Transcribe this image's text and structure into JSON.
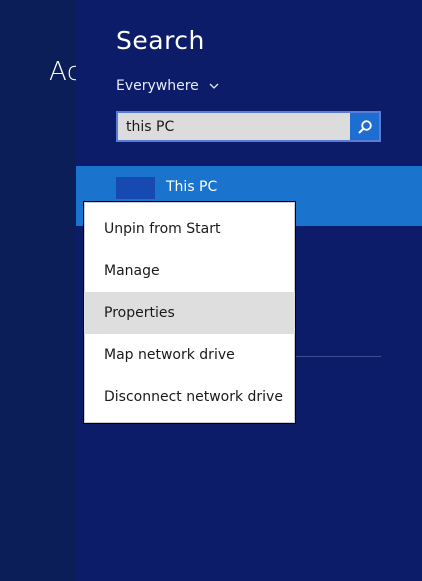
{
  "start_screen": {
    "peek_text": "Ac"
  },
  "search": {
    "title": "Search",
    "scope": "Everywhere",
    "query": "this PC",
    "search_button_icon": "search-icon"
  },
  "results": [
    {
      "label": "This PC",
      "tile_color": "#1749b3"
    }
  ],
  "context_menu": {
    "items": [
      {
        "label": "Unpin from Start",
        "highlighted": false
      },
      {
        "label": "Manage",
        "highlighted": false
      },
      {
        "label": "Properties",
        "highlighted": true
      },
      {
        "label": "Map network drive",
        "highlighted": false
      },
      {
        "label": "Disconnect network drive",
        "highlighted": false
      }
    ]
  },
  "colors": {
    "pane_background": "#0d1c68",
    "selected_result": "#1a73cc",
    "accent": "#1c6ed0",
    "menu_highlight": "#dedede"
  }
}
